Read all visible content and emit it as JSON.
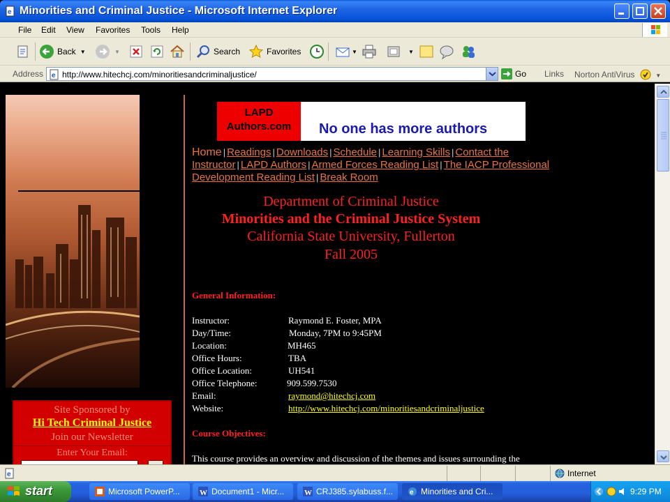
{
  "window": {
    "title": "Minorities and Criminal Justice - Microsoft Internet Explorer"
  },
  "menu": [
    "File",
    "Edit",
    "View",
    "Favorites",
    "Tools",
    "Help"
  ],
  "toolbar": {
    "back_label": "Back",
    "search_label": "Search",
    "favorites_label": "Favorites"
  },
  "address": {
    "label": "Address",
    "url": "http://www.hitechcj.com/minoritiesandcriminaljustice/",
    "go_label": "Go",
    "links_label": "Links",
    "norton_label": "Norton AntiVirus"
  },
  "banner": {
    "lapd_line1": "LAPD",
    "lapd_line2": "Authors.com",
    "tagline": "No one has more authors"
  },
  "nav": {
    "home": "Home",
    "separator": "|",
    "links": [
      "Readings",
      "Downloads",
      "Schedule",
      "Learning Skills",
      "Contact the Instructor",
      "LAPD Authors",
      "Armed Forces Reading List",
      "The IACP Professional Development Reading List",
      "Break Room"
    ]
  },
  "headings": {
    "dept": "Department of Criminal Justice",
    "course": "Minorities and the Criminal Justice System",
    "university": "California State University, Fullerton",
    "term": "Fall 2005"
  },
  "general": {
    "title": "General Information:",
    "rows": [
      {
        "label": "Instructor:",
        "value": "Raymond E. Foster, MPA"
      },
      {
        "label": "Day/Time:",
        "value": "Monday, 7PM to 9:45PM"
      },
      {
        "label": "Location:",
        "value": "MH465"
      },
      {
        "label": "Office Hours:",
        "value": "TBA"
      },
      {
        "label": "Office Location:",
        "value": "UH541"
      },
      {
        "label": "Office Telephone:",
        "value": "909.599.7530"
      },
      {
        "label": "Email:",
        "value": "raymond@hitechcj.com"
      },
      {
        "label": "Website:",
        "value": "http://www.hitechcj.com/minoritiesandcriminaljustice"
      }
    ]
  },
  "objectives": {
    "title": "Course Objectives:",
    "text": "This course provides an overview and discussion of the themes and issues surrounding the"
  },
  "sponsor": {
    "line1": "Site Sponsored by",
    "line2": "Hi Tech Criminal Justice",
    "line3": "Join our Newsletter",
    "line4": "Enter Your Email:"
  },
  "status": {
    "zone": "Internet"
  },
  "taskbar": {
    "start_label": "start",
    "items": [
      "Microsoft PowerP...",
      "Document1 - Micr...",
      "CRJ385.sylabuss.f...",
      "Minorities and Cri..."
    ],
    "clock": "9:29 PM"
  }
}
